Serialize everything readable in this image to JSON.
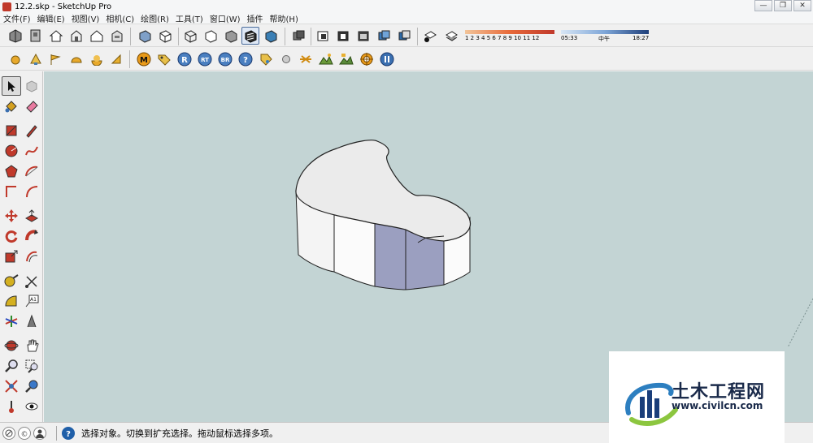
{
  "window": {
    "title": "12.2.skp - SketchUp Pro",
    "minimize": "—",
    "restore": "❐",
    "close": "✕"
  },
  "menu": [
    "文件(F)",
    "编辑(E)",
    "视图(V)",
    "相机(C)",
    "绘图(R)",
    "工具(T)",
    "窗口(W)",
    "插件",
    "帮助(H)"
  ],
  "shadow": {
    "month_ticks": "1  2  3  4  5  6  7  8  9  10 11 12",
    "time_start": "05:33",
    "time_mid": "中午",
    "time_end": "18:27"
  },
  "status": {
    "hint": "选择对象。切换到扩充选择。拖动鼠标选择多项。"
  },
  "watermark": {
    "name": "土木工程网",
    "url": "www.civilcn.com"
  },
  "colors": {
    "viewport": "#c3d4d4",
    "model_face": "#ebebeb",
    "model_side": "#f5f5f5",
    "model_selected": "#9b9fc0",
    "accent": "#4b6c9c"
  }
}
